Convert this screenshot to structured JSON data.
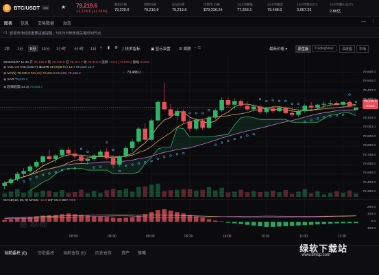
{
  "header": {
    "coin_letter": "₿",
    "pair": "BTC/USDT",
    "badge": "10x",
    "star": "★",
    "price": "79,219.6",
    "change": "+1,174.6 (+1.51%)",
    "stats": [
      {
        "label": "最新价格",
        "value": "79,220.0"
      },
      {
        "label": "指数价格",
        "value": "79,216.9"
      },
      {
        "label": "标记价格",
        "value": "79,219.6"
      },
      {
        "label": "比特币 价格",
        "value": "$79,236.24"
      },
      {
        "label": "24小时最低",
        "value": "77,358.1"
      },
      {
        "label": "24小时最高",
        "value": "79,488.0"
      },
      {
        "label": "24小时量(BTC)",
        "value": "3,657.26"
      },
      {
        "label": "24小时额(USDT)",
        "value": "2.86亿"
      }
    ]
  },
  "tabs": [
    "图表",
    "信息",
    "交易数据",
    "动态"
  ],
  "notice": "欧易市场动态重要进度提醒，5月25日修改或关键时间节点",
  "timeframes": [
    "1秒",
    "1分",
    "5分",
    "15分",
    "1小时",
    "4小时",
    "1日"
  ],
  "tools": {
    "indicators": "技术指标",
    "display": "显示设置",
    "alerts": "周期",
    "ctrl": "-- ☰"
  },
  "view_menu": "最新价格",
  "views": [
    "原生版",
    "TradingView",
    "深度图",
    "市场"
  ],
  "legend": {
    "line1": {
      "date": "2026/04/27 11:40",
      "o": "开",
      "o_v": "79,195.2",
      "h": "高",
      "h_v": "79,220.9",
      "l": "低",
      "l_v": "79,191.7",
      "c": "收",
      "c_v": "79,219.6",
      "chg": "涨跌",
      "chg_v": "+24.0 (+0.03%)",
      "amp": "振幅",
      "amp_v": "0.04%"
    },
    "vol": {
      "label": "VOL 0.5",
      "v1": "VOL(USDT)",
      "v1v": "40.37K",
      "v2": "MA(5)(BTC)",
      "v2v": "12.7",
      "v3": "MA(10)",
      "v3v": "13.7"
    },
    "ma": {
      "label": "MA(5)",
      "ma5": "79,230.3",
      "ma10l": "MA(10)",
      "ma10": "79,204.2",
      "ma30l": "MA(30)",
      "ma30": "79,136.2"
    },
    "sar": {
      "label": "SAR",
      "v": "79,041.2"
    },
    "env": {
      "label": "超级趋势(14,3)",
      "v": "78,928.7"
    },
    "macd": {
      "label": "MACD(12, 26, 9)",
      "macdl": "MACD",
      "macd": "-15.0",
      "difl": "DIF",
      "dif": "66.3",
      "deal": "DEA",
      "dea": "73.9"
    }
  },
  "yaxis": [
    "79,600.0",
    "79,500.0",
    "79,400.0",
    "79,300.0",
    "79,200.0",
    "79,100.0",
    "79,000.0",
    "78,900.0",
    "78,800.0",
    "78,700.0",
    "78,600.0",
    "78,500.0",
    "78,400.0",
    "78,300.0"
  ],
  "macd_axis": [
    "200.0",
    "100.0",
    "0.0",
    "-100.0"
  ],
  "xaxis": [
    "08:00",
    "08:30",
    "09:00",
    "09:30",
    "10:00",
    "10:30",
    "11:00",
    "11:30"
  ],
  "high_marker": "79,488.0",
  "current": {
    "price": "79,219.6",
    "timer": "02:59"
  },
  "chart_data": {
    "type": "candlestick",
    "x": [
      "07:05",
      "07:10",
      "07:15",
      "07:20",
      "07:25",
      "07:30",
      "07:35",
      "07:40",
      "07:45",
      "07:50",
      "07:55",
      "08:00",
      "08:05",
      "08:10",
      "08:15",
      "08:20",
      "08:25",
      "08:30",
      "08:35",
      "08:40",
      "08:45",
      "08:50",
      "08:55",
      "09:00",
      "09:05",
      "09:10",
      "09:15",
      "09:20",
      "09:25",
      "09:30",
      "09:35",
      "09:40",
      "09:45",
      "09:50",
      "09:55",
      "10:00",
      "10:05",
      "10:10",
      "10:15",
      "10:20",
      "10:25",
      "10:30",
      "10:35",
      "10:40",
      "10:45",
      "10:50",
      "10:55",
      "11:00",
      "11:05",
      "11:10",
      "11:15",
      "11:20",
      "11:25",
      "11:30",
      "11:35",
      "11:40"
    ],
    "ohlc": [
      [
        78370,
        78420,
        78330,
        78400
      ],
      [
        78400,
        78460,
        78380,
        78440
      ],
      [
        78440,
        78520,
        78420,
        78500
      ],
      [
        78500,
        78560,
        78470,
        78530
      ],
      [
        78530,
        78600,
        78500,
        78580
      ],
      [
        78580,
        78650,
        78560,
        78630
      ],
      [
        78630,
        78700,
        78600,
        78690
      ],
      [
        78690,
        78760,
        78640,
        78660
      ],
      [
        78660,
        78720,
        78620,
        78700
      ],
      [
        78700,
        78780,
        78680,
        78760
      ],
      [
        78760,
        78790,
        78700,
        78720
      ],
      [
        78720,
        78760,
        78670,
        78690
      ],
      [
        78690,
        78710,
        78620,
        78640
      ],
      [
        78640,
        78680,
        78600,
        78660
      ],
      [
        78660,
        78720,
        78640,
        78700
      ],
      [
        78700,
        78760,
        78680,
        78740
      ],
      [
        78740,
        78780,
        78650,
        78670
      ],
      [
        78670,
        78700,
        78560,
        78600
      ],
      [
        78600,
        78700,
        78580,
        78690
      ],
      [
        78690,
        78800,
        78670,
        78780
      ],
      [
        78780,
        78880,
        78740,
        78850
      ],
      [
        78850,
        79010,
        78830,
        78990
      ],
      [
        78990,
        79050,
        78860,
        78870
      ],
      [
        78870,
        79100,
        78850,
        79080
      ],
      [
        79080,
        79300,
        79060,
        79280
      ],
      [
        79280,
        79488,
        79180,
        79200
      ],
      [
        79200,
        79260,
        79100,
        79130
      ],
      [
        79130,
        79210,
        79080,
        79180
      ],
      [
        79180,
        79200,
        79050,
        79070
      ],
      [
        79070,
        79100,
        78960,
        78990
      ],
      [
        78990,
        79100,
        78970,
        79080
      ],
      [
        79080,
        79100,
        78980,
        79000
      ],
      [
        79000,
        79130,
        78990,
        79110
      ],
      [
        79110,
        79210,
        79090,
        79190
      ],
      [
        79190,
        79330,
        79170,
        79300
      ],
      [
        79300,
        79330,
        79220,
        79250
      ],
      [
        79250,
        79320,
        79200,
        79290
      ],
      [
        79290,
        79310,
        79220,
        79240
      ],
      [
        79240,
        79280,
        79180,
        79200
      ],
      [
        79200,
        79260,
        79170,
        79230
      ],
      [
        79230,
        79250,
        79150,
        79170
      ],
      [
        79170,
        79230,
        79150,
        79210
      ],
      [
        79210,
        79240,
        79160,
        79180
      ],
      [
        79180,
        79230,
        79170,
        79220
      ],
      [
        79220,
        79230,
        79150,
        79160
      ],
      [
        79160,
        79200,
        79120,
        79140
      ],
      [
        79140,
        79200,
        79120,
        79180
      ],
      [
        79180,
        79260,
        79160,
        79240
      ],
      [
        79240,
        79280,
        79200,
        79220
      ],
      [
        79220,
        79260,
        79200,
        79250
      ],
      [
        79250,
        79290,
        79230,
        79260
      ],
      [
        79260,
        79300,
        79240,
        79270
      ],
      [
        79270,
        79290,
        79240,
        79250
      ],
      [
        79250,
        79290,
        79230,
        79280
      ],
      [
        79280,
        79300,
        79220,
        79230
      ],
      [
        79195,
        79221,
        79192,
        79220
      ]
    ],
    "macd_hist": [
      30,
      40,
      50,
      60,
      70,
      80,
      90,
      95,
      100,
      110,
      120,
      110,
      100,
      90,
      80,
      75,
      70,
      60,
      55,
      60,
      70,
      90,
      110,
      140,
      170,
      180,
      160,
      140,
      120,
      100,
      80,
      60,
      40,
      20,
      10,
      -10,
      -20,
      -30,
      -40,
      -50,
      -60,
      -70,
      -70,
      -65,
      -60,
      -55,
      -50,
      -45,
      -40,
      -35,
      -30,
      -25,
      -20,
      -18,
      -16,
      -15
    ],
    "ylim": [
      78280,
      79650
    ],
    "macd_ylim": [
      -140,
      230
    ]
  }
}
